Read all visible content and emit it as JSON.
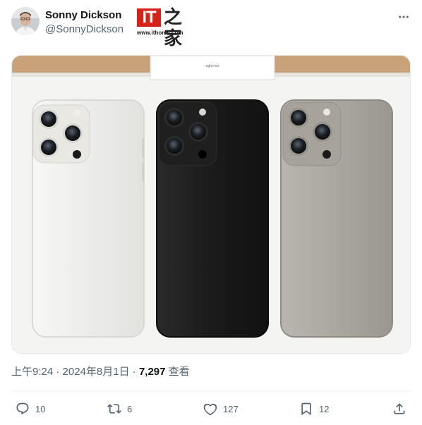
{
  "author": {
    "display_name": "Sonny Dickson",
    "handle": "@SonnyDickson"
  },
  "source": {
    "logo_it": "IT",
    "logo_zh": "之家",
    "url": "www.ithome.com"
  },
  "media": {
    "box_label": "ogho iez",
    "phone_colors": [
      "#eeeeec",
      "#1e1e1e",
      "#a9a6a0"
    ],
    "background": "#f5f5f3"
  },
  "meta": {
    "time": "上午9:24",
    "separator": " · ",
    "date": "2024年8月1日",
    "separator2": " · ",
    "views_count": "7,297",
    "views_label": " 查看"
  },
  "actions": {
    "replies": "10",
    "reposts": "6",
    "likes": "127",
    "bookmarks": "12"
  },
  "icons": {
    "more": "more-horizontal-icon",
    "reply": "reply-icon",
    "repost": "repost-icon",
    "like": "heart-icon",
    "bookmark": "bookmark-icon",
    "share": "share-icon"
  },
  "colors": {
    "text_primary": "#0f1419",
    "text_secondary": "#536471",
    "divider": "#eff3f4",
    "logo_red": "#d7221b"
  }
}
